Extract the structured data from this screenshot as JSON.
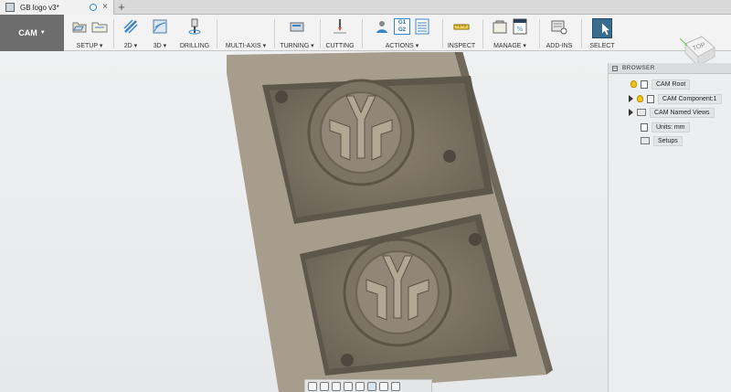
{
  "tab": {
    "title": "GB logo v3*",
    "close": "×",
    "new": "+"
  },
  "workspace": {
    "label": "CAM"
  },
  "toolbar": {
    "groups": [
      {
        "label": "SETUP ▾"
      },
      {
        "label": "2D ▾"
      },
      {
        "label": "3D ▾"
      },
      {
        "label": "DRILLING"
      },
      {
        "label": "MULTI-AXIS ▾"
      },
      {
        "label": "TURNING ▾"
      },
      {
        "label": "CUTTING"
      },
      {
        "label": "ACTIONS ▾"
      },
      {
        "label": "INSPECT"
      },
      {
        "label": "MANAGE ▾"
      },
      {
        "label": "ADD-INS"
      },
      {
        "label": "SELECT"
      }
    ],
    "actions_glyph": {
      "top": "G1",
      "bottom": "G2"
    }
  },
  "viewcube": {
    "face": "TOP"
  },
  "browser": {
    "header": "BROWSER",
    "nodes": [
      {
        "label": "CAM Root"
      },
      {
        "label": "CAM Component:1"
      },
      {
        "label": "CAM Named Views"
      },
      {
        "label": "Units: mm"
      },
      {
        "label": "Setups"
      }
    ]
  },
  "colors": {
    "accent": "#3a83c5",
    "mold_top": "#a49b8b",
    "mold_side": "#7d7567",
    "mold_face": "#8f8674",
    "workspace_bg": "#6d6d6d"
  }
}
